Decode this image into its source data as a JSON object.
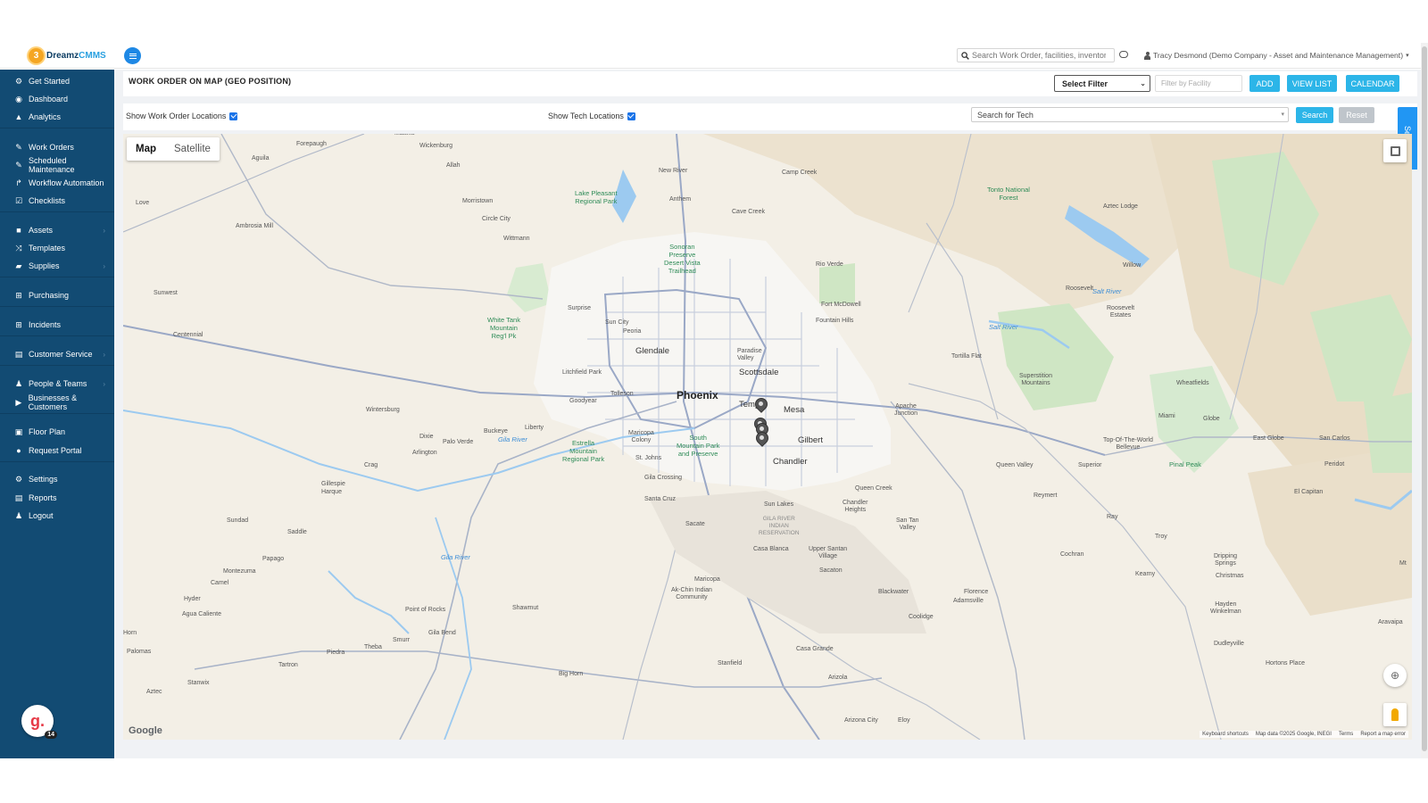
{
  "header": {
    "logo_text": "Dreamz",
    "logo_accent": "CMMS",
    "search_placeholder": "Search Work Order, facilities, inventory...",
    "user_label": "Tracy Desmond (Demo Company - Asset and Maintenance Management)"
  },
  "sidebar": {
    "items": [
      {
        "label": "Get Started",
        "icon": "gears-icon"
      },
      {
        "label": "Dashboard",
        "icon": "dashboard-icon"
      },
      {
        "label": "Analytics",
        "icon": "analytics-icon"
      },
      {
        "label": "Work Orders",
        "icon": "wrench-icon"
      },
      {
        "label": "Scheduled Maintenance",
        "icon": "wrench-icon"
      },
      {
        "label": "Workflow Automation",
        "icon": "flow-icon"
      },
      {
        "label": "Checklists",
        "icon": "checkbox-icon"
      },
      {
        "label": "Assets",
        "icon": "box-icon"
      },
      {
        "label": "Templates",
        "icon": "shuffle-icon"
      },
      {
        "label": "Supplies",
        "icon": "briefcase-icon"
      },
      {
        "label": "Purchasing",
        "icon": "cart-icon"
      },
      {
        "label": "Incidents",
        "icon": "cart-icon"
      },
      {
        "label": "Customer Service",
        "icon": "document-icon"
      },
      {
        "label": "People & Teams",
        "icon": "users-icon"
      },
      {
        "label": "Businesses & Customers",
        "icon": "video-icon"
      },
      {
        "label": "Floor Plan",
        "icon": "print-icon"
      },
      {
        "label": "Request Portal",
        "icon": "chat-icon"
      },
      {
        "label": "Settings",
        "icon": "gear-icon"
      },
      {
        "label": "Reports",
        "icon": "document-icon"
      },
      {
        "label": "Logout",
        "icon": "user-icon"
      }
    ],
    "grammarly_badge": "14"
  },
  "page": {
    "title": "WORK ORDER ON MAP (GEO POSITION)",
    "select_filter": "Select Filter",
    "facility_placeholder": "Filter by Facility",
    "add_label": "ADD",
    "viewlist_label": "VIEW LIST",
    "calendar_label": "CALENDAR",
    "show_wo_label": "Show Work Order Locations",
    "show_tech_label": "Show Tech Locations",
    "tech_search_value": "Search for Tech",
    "search_label": "Search",
    "reset_label": "Reset",
    "side_tab_label": "Search"
  },
  "map": {
    "type_map": "Map",
    "type_satellite": "Satellite",
    "google": "Google",
    "footer": [
      "Keyboard shortcuts",
      "Map data ©2025 Google, INEGI",
      "Terms",
      "Report a map error"
    ],
    "big_cities": [
      "Phoenix"
    ],
    "cities": [
      "Glendale",
      "Scottsdale",
      "Mesa",
      "Gilbert",
      "Chandler",
      "Tempe"
    ],
    "places": [
      "Matthie",
      "Forepaugh",
      "Wickenburg",
      "Aguila",
      "Allah",
      "New River",
      "Camp Creek",
      "Anthem",
      "Cave Creek",
      "Morristown",
      "Circle City",
      "Wittmann",
      "Love",
      "Ambrosia Mill",
      "Surprise",
      "Sun City",
      "Peoria",
      "Rio Verde",
      "Fort McDowell",
      "Fountain Hills",
      "Paradise Valley",
      "Sunwest",
      "Centennial",
      "Litchfield Park",
      "Tolleson",
      "Goodyear",
      "Buckeye",
      "Liberty",
      "Palo Verde",
      "Arlington",
      "Wintersburg",
      "Dixie",
      "Crag",
      "Gillespie",
      "Harque",
      "Maricopa Colony",
      "St. Johns",
      "Gila Crossing",
      "Santa Cruz",
      "Sun Lakes",
      "Queen Creek",
      "Chandler Heights",
      "Apache Junction",
      "Sacate",
      "San Tan Valley",
      "Sundad",
      "Saddle",
      "Papago",
      "Montezuma",
      "Camel",
      "Hyder",
      "Agua Caliente",
      "Point of Rocks",
      "Shawmut",
      "Maricopa",
      "Ak-Chin Indian Community",
      "Casa Blanca",
      "Upper Santan Village",
      "Sacaton",
      "Blackwater",
      "Adamsville",
      "Florence",
      "Coolidge",
      "Gila Bend",
      "Smurr",
      "Theba",
      "Piedra",
      "Tartron",
      "Stanwix",
      "Palomas",
      "Horn",
      "Aztec",
      "Big Horn",
      "Stanfield",
      "Casa Grande",
      "Arizola",
      "Arizona City",
      "Eloy",
      "Tortilla Flat",
      "Superstition Mountains",
      "Roosevelt",
      "Roosevelt Estates",
      "Willow",
      "Wheatfields",
      "Miami",
      "Globe",
      "East Globe",
      "San Carlos",
      "Top-Of-The-World",
      "Bellevue",
      "Queen Valley",
      "Superior",
      "Reymert",
      "Ray",
      "Troy",
      "Cochran",
      "Kearny",
      "Dripping Springs",
      "Christmas",
      "Hayden",
      "Winkelman",
      "Dudleyville",
      "Hortons Place",
      "Peridot",
      "El Capitan",
      "Aravaipa",
      "Tonto National Forest",
      "Aztec Lodge",
      "Mt"
    ],
    "parks": [
      "Lake Pleasant Regional Park",
      "Sonoran Preserve Desert Vista Trailhead",
      "White Tank Mountain Reg'l Pk",
      "Estrella Mountain Regional Park",
      "South Mountain Park and Preserve",
      "Pinal Peak"
    ],
    "waters": [
      "Gila River",
      "Salt River",
      "Salt River",
      "Gila River"
    ],
    "reservation": "GILA RIVER INDIAN RESERVATION",
    "work_order_pins": 4
  },
  "colors": {
    "sidebar_bg": "#124b73",
    "accent_button": "#2cb5e8",
    "map_land": "#f3efe6"
  }
}
